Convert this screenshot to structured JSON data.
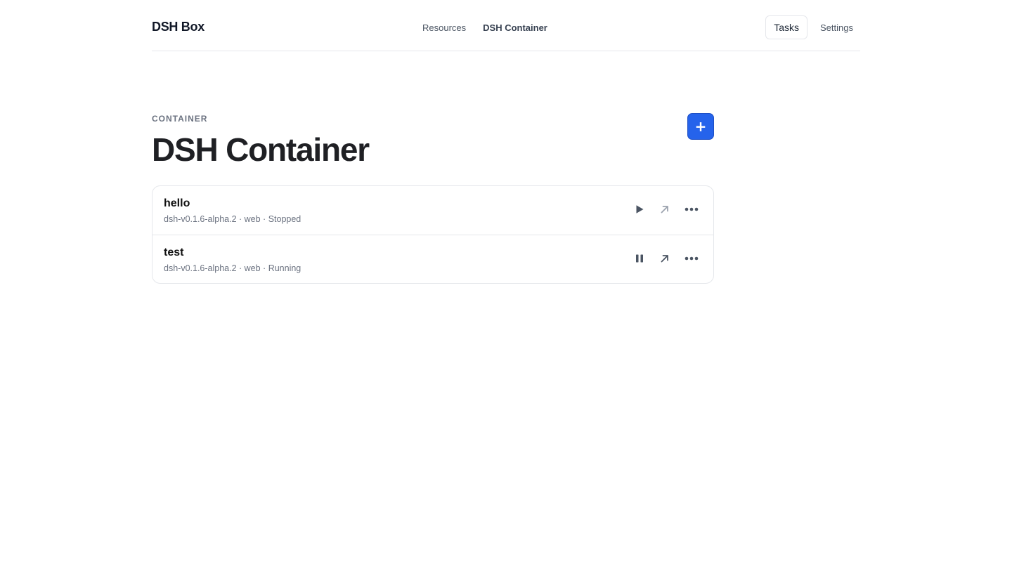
{
  "header": {
    "brand": "DSH Box",
    "nav": [
      {
        "label": "Resources",
        "active": false
      },
      {
        "label": "DSH Container",
        "active": true
      }
    ],
    "tasks_label": "Tasks",
    "settings_label": "Settings"
  },
  "main": {
    "eyebrow": "CONTAINER",
    "title": "DSH Container",
    "add_label": "+",
    "rows": [
      {
        "name": "hello",
        "meta": "dsh-v0.1.6-alpha.2 · web · Stopped",
        "state": "Stopped",
        "toggle_icon": "play-icon",
        "open_icon": "arrow-up-right-icon",
        "menu_icon": "more-horizontal-icon"
      },
      {
        "name": "test",
        "meta": "dsh-v0.1.6-alpha.2 · web · Running",
        "state": "Running",
        "toggle_icon": "pause-icon",
        "open_icon": "arrow-up-right-icon",
        "menu_icon": "more-horizontal-icon"
      }
    ]
  },
  "colors": {
    "accent": "#2563eb",
    "border": "#e5e7eb",
    "muted_text": "#6b7280"
  }
}
